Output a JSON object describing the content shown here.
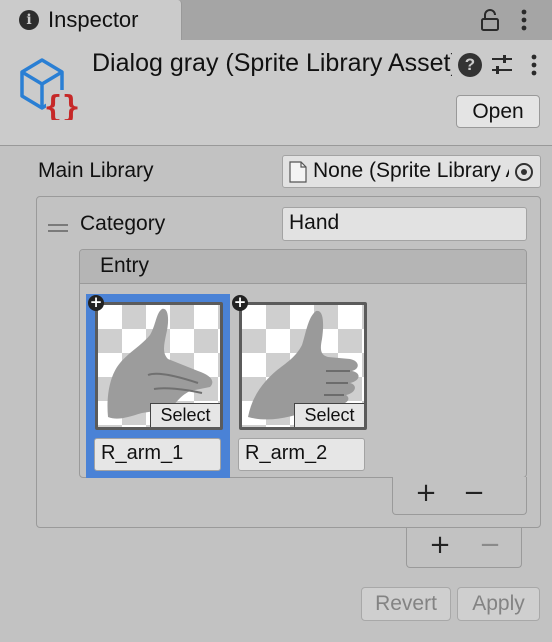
{
  "tab": {
    "icon": "info-icon",
    "label": "Inspector"
  },
  "tab_actions": {
    "lock": "lock-icon",
    "menu": "kebab-menu-icon"
  },
  "header": {
    "asset_icon": "sprite-library-asset-icon",
    "title": "Dialog gray (Sprite Library Asset)",
    "help_icon_glyph": "?",
    "presets_icon": "sliders-icon",
    "menu_icon": "kebab-menu-icon",
    "open_label": "Open"
  },
  "main_library": {
    "label": "Main Library",
    "value": "None (Sprite Library Asset)"
  },
  "category": {
    "label": "Category",
    "value": "Hand",
    "entry": {
      "label": "Entry",
      "sprites": [
        {
          "name": "R_arm_1",
          "select_label": "Select",
          "selected": true,
          "badge": "+"
        },
        {
          "name": "R_arm_2",
          "select_label": "Select",
          "selected": false,
          "badge": "+"
        }
      ],
      "add_label": "+",
      "remove_label": "−"
    },
    "add_label": "+",
    "remove_label": "−"
  },
  "footer": {
    "revert_label": "Revert",
    "apply_label": "Apply"
  },
  "colors": {
    "selection": "#4a82d6",
    "asset_blue": "#2a7fd4",
    "asset_red": "#c62828"
  }
}
